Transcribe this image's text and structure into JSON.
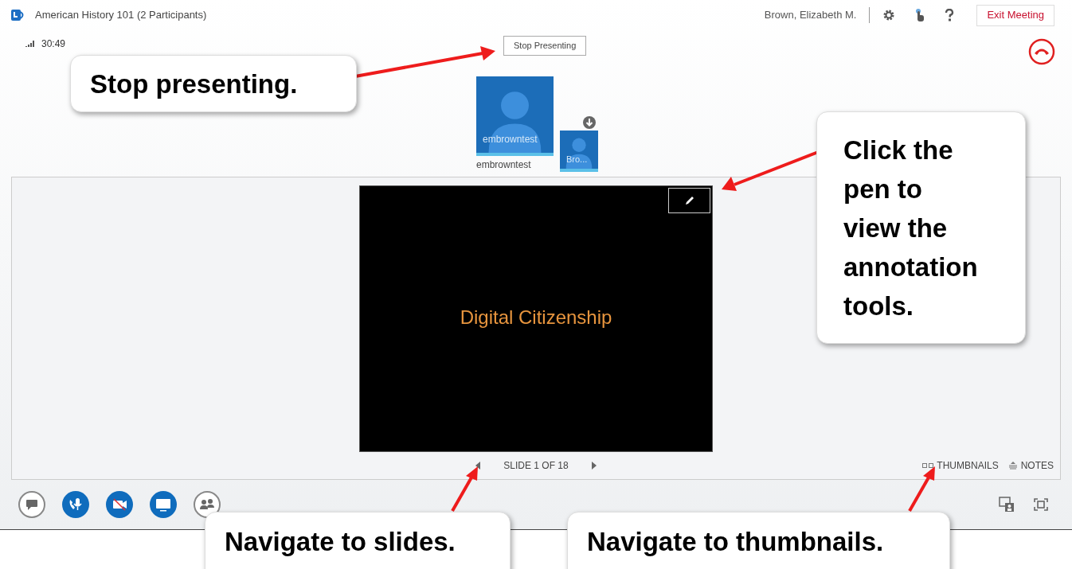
{
  "window": {
    "title": "American History 101 (2 Participants)"
  },
  "timer": "30:49",
  "user": {
    "name": "Brown, Elizabeth M."
  },
  "exit_button": "Exit Meeting",
  "stop_presenting_button": "Stop Presenting",
  "participants": [
    {
      "tile_label": "embrowntest",
      "caption": "embrowntest",
      "kind": "large"
    },
    {
      "tile_label": "Bro...",
      "kind": "small"
    }
  ],
  "slide": {
    "title": "Digital Citizenship",
    "counter": "SLIDE 1 OF 18"
  },
  "view_links": [
    {
      "kind": "thumbnails",
      "label": "THUMBNAILS"
    },
    {
      "kind": "notes",
      "label": "NOTES"
    }
  ],
  "toolbar": [
    {
      "kind": "chat",
      "active": false
    },
    {
      "kind": "audio",
      "active": true
    },
    {
      "kind": "video",
      "active": true
    },
    {
      "kind": "present",
      "active": true
    },
    {
      "kind": "people",
      "active": false
    }
  ],
  "callouts": [
    {
      "kind": "stop",
      "text": "Stop presenting."
    },
    {
      "kind": "pen",
      "text": "Click the pen to view the annotation tools."
    },
    {
      "kind": "slides",
      "text": "Navigate to slides."
    },
    {
      "kind": "thumbs",
      "text": "Navigate to thumbnails."
    }
  ]
}
